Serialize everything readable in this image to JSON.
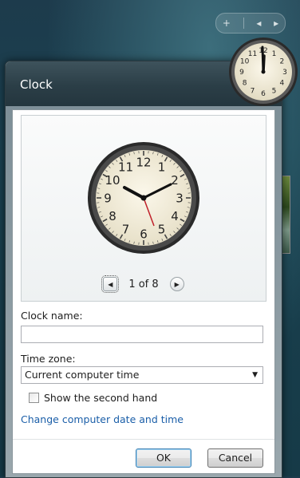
{
  "dialog": {
    "title": "Clock",
    "preview": {
      "page_indicator": "1 of 8"
    },
    "clock_name_label": "Clock name:",
    "clock_name_value": "",
    "time_zone_label": "Time zone:",
    "time_zone_value": "Current computer time",
    "second_hand_label": "Show the second hand",
    "second_hand_checked": false,
    "change_datetime_link": "Change computer date and time",
    "ok_label": "OK",
    "cancel_label": "Cancel"
  },
  "gadget_toolbar": {
    "add": "+",
    "prev": "◂",
    "next": "▸"
  },
  "clock_numerals": [
    "12",
    "1",
    "2",
    "3",
    "4",
    "5",
    "6",
    "7",
    "8",
    "9",
    "10",
    "11"
  ],
  "colors": {
    "link": "#1a5ea8",
    "second_hand": "#c0202a",
    "titlebar": "#2b3e47"
  }
}
